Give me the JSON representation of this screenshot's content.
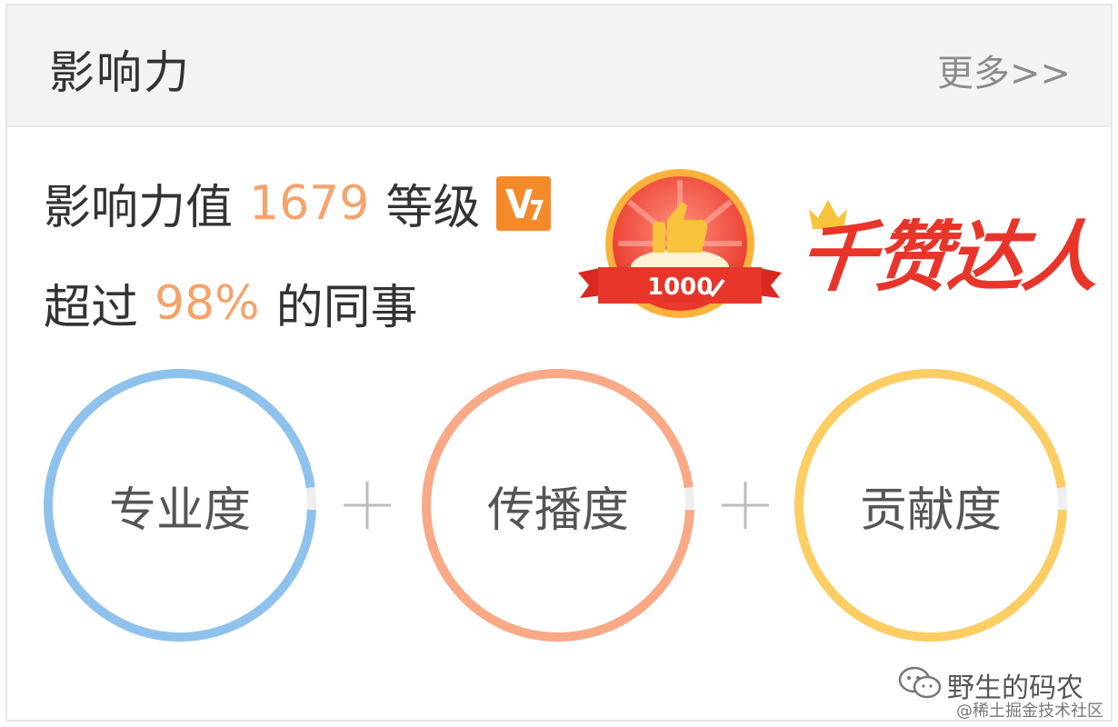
{
  "header": {
    "title": "影响力",
    "more_link": "更多>>"
  },
  "summary": {
    "influence_label": "影响力值",
    "influence_value": "1679",
    "level_label": "等级",
    "level_icon": "level-v7-badge",
    "exceed_label": "超过",
    "exceed_value": "98%",
    "exceed_suffix": "的同事"
  },
  "achievement": {
    "medal_text": "1000",
    "title": "千赞达人",
    "icon": "thumbs-up-medal"
  },
  "dimensions": [
    {
      "label": "专业度",
      "color": "#8ec2ec"
    },
    {
      "label": "传播度",
      "color": "#f9a985"
    },
    {
      "label": "贡献度",
      "color": "#fbcd62"
    }
  ],
  "watermark": {
    "name": "野生的码农",
    "sub": "@稀土掘金技术社区"
  },
  "colors": {
    "accent_number": "#f5a26b",
    "header_bg": "#f3f3f3"
  }
}
